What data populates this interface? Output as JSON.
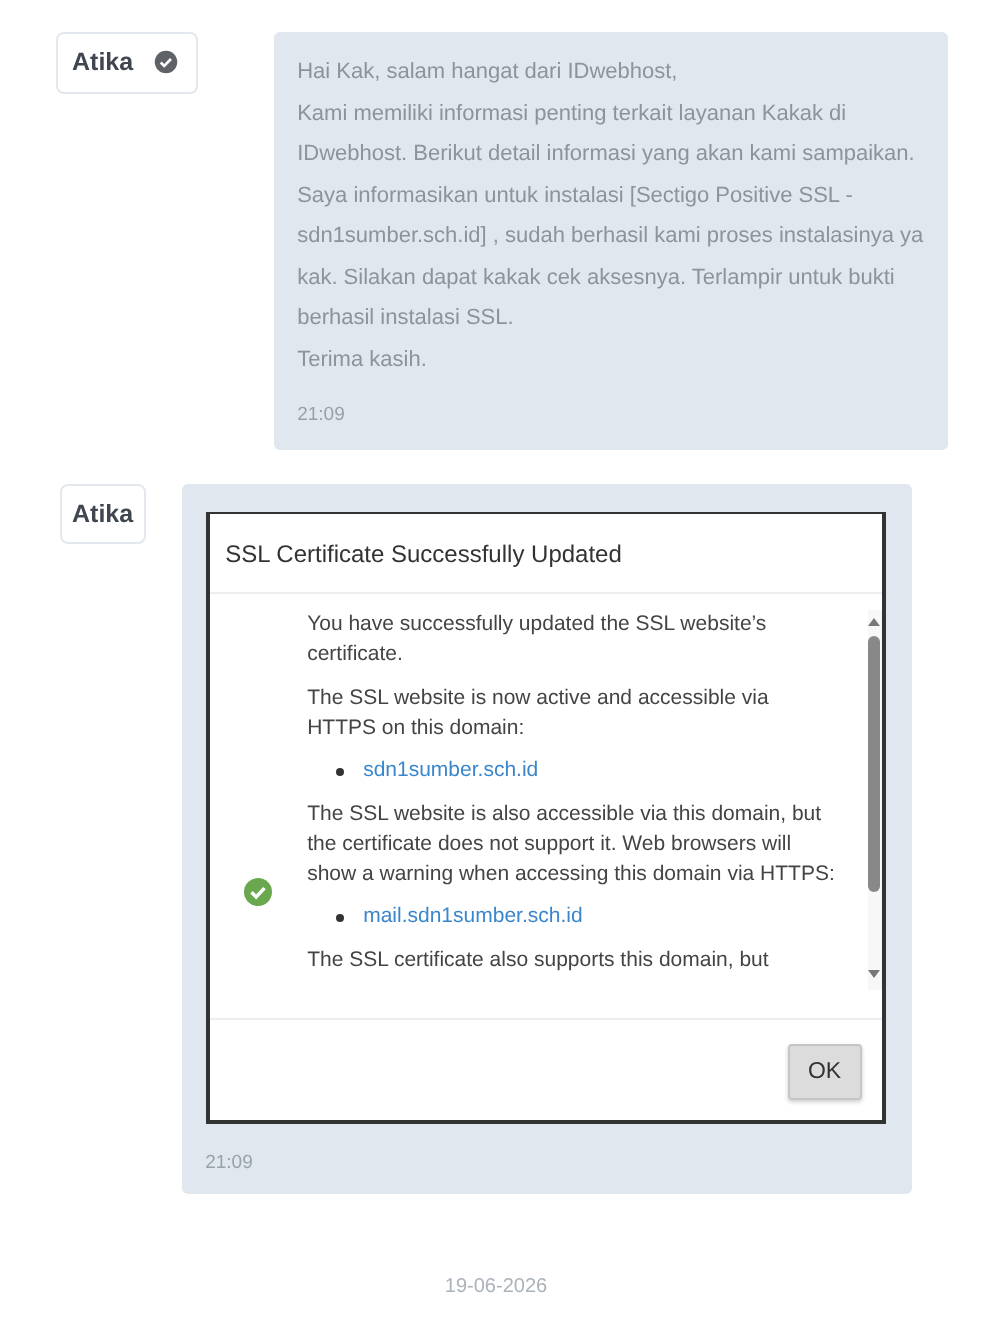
{
  "messages": [
    {
      "sender": "Atika",
      "verified": true,
      "lines": [
        "Hai Kak, salam hangat dari IDwebhost,",
        "Kami memiliki informasi penting terkait layanan Kakak di",
        "IDwebhost. Berikut detail informasi yang akan kami sampaikan.",
        "Saya informasikan untuk instalasi [Sectigo Positive SSL -",
        "sdn1sumber.sch.id] , sudah berhasil kami proses instalasinya ya",
        "kak. Silakan dapat kakak cek aksesnya. Terlampir untuk bukti",
        "berhasil instalasi SSL.",
        "Terima kasih."
      ],
      "time": "21:09"
    },
    {
      "sender": "Atika",
      "verified": false,
      "attachment": {
        "title": "SSL Certificate Successfully Updated",
        "blocks": [
          {
            "kind": "text",
            "text": "You have successfully updated the SSL website’s certificate."
          },
          {
            "kind": "text",
            "text": "The SSL website is now active and accessible via HTTPS on this domain:"
          },
          {
            "kind": "link",
            "text": "sdn1sumber.sch.id"
          },
          {
            "kind": "text",
            "text": "The SSL website is also accessible via this domain, but the certificate does not support it. Web browsers will show a warning when accessing this domain via HTTPS:"
          },
          {
            "kind": "link",
            "text": "mail.sdn1sumber.sch.id"
          },
          {
            "kind": "text",
            "text": "The SSL certificate also supports this domain, but"
          }
        ],
        "button": "OK"
      },
      "time": "21:09"
    }
  ],
  "date": "19-06-2026"
}
